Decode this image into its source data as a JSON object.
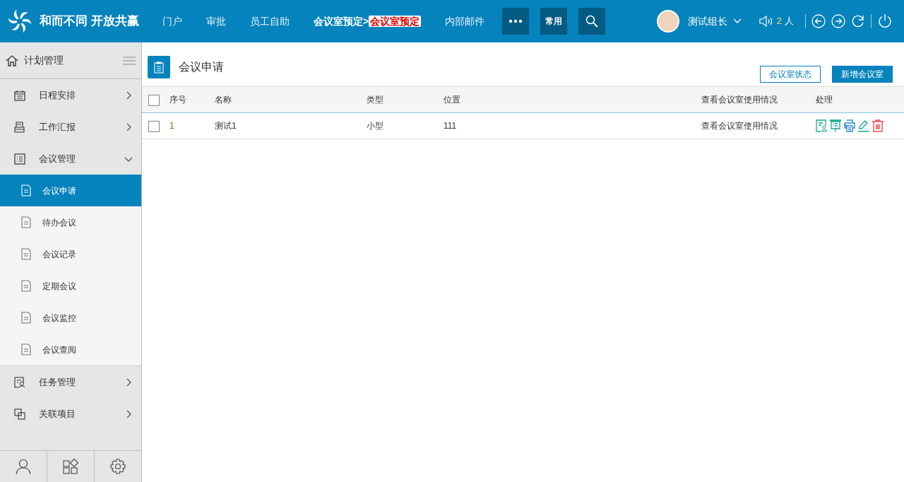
{
  "brand": {
    "title": "和而不同 开放共赢"
  },
  "nav": [
    {
      "label": "门户",
      "selected": false
    },
    {
      "label": "审批",
      "selected": false
    },
    {
      "label": "员工自助",
      "selected": false
    },
    {
      "label": "会议室预定>",
      "highlight": "会议室预定",
      "selected": true
    },
    {
      "label": "内部邮件",
      "selected": false
    }
  ],
  "header_buttons": [
    {
      "kind": "more"
    },
    {
      "kind": "text",
      "label": "常用"
    },
    {
      "kind": "search"
    }
  ],
  "user": {
    "name": "测试组长",
    "speaker_count": "2",
    "speaker_unit": "人"
  },
  "sidebar": {
    "title": "计划管理",
    "items": [
      {
        "label": "日程安排",
        "kind": "calendar",
        "expanded": false
      },
      {
        "label": "工作汇报",
        "kind": "inbox",
        "expanded": false
      },
      {
        "label": "会议管理",
        "kind": "list",
        "expanded": true,
        "children": [
          {
            "label": "会议申请",
            "selected": true
          },
          {
            "label": "待办会议",
            "selected": false
          },
          {
            "label": "会议记录",
            "selected": false
          },
          {
            "label": "定期会议",
            "selected": false
          },
          {
            "label": "会议监控",
            "selected": false
          },
          {
            "label": "会议查阅",
            "selected": false
          }
        ]
      },
      {
        "label": "任务管理",
        "kind": "task",
        "expanded": false
      },
      {
        "label": "关联项目",
        "kind": "link",
        "expanded": false
      }
    ]
  },
  "page": {
    "title": "会议申请",
    "buttons": [
      {
        "label": "会议室状态",
        "kind": "outline"
      },
      {
        "label": "新增会议室",
        "kind": "primary"
      }
    ]
  },
  "table": {
    "all_checked": false,
    "columns": [
      "序号",
      "名称",
      "类型",
      "位置",
      "查看会议室使用情况",
      "处理"
    ],
    "rows": [
      {
        "checked": false,
        "cells": [
          "1",
          "测试1",
          "小型",
          "111",
          "查看会议室使用情况"
        ]
      }
    ]
  }
}
